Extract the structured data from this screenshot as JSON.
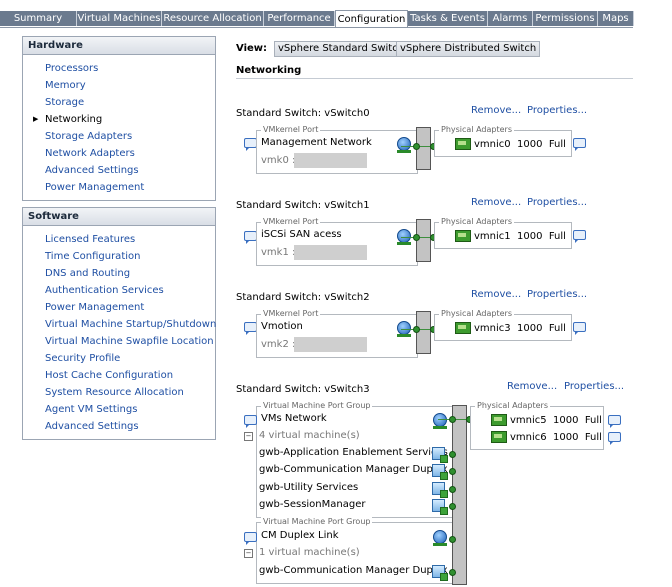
{
  "tabs": [
    "Summary",
    "Virtual Machines",
    "Resource Allocation",
    "Performance",
    "Configuration",
    "Tasks & Events",
    "Alarms",
    "Permissions",
    "Maps"
  ],
  "active_tab": "Configuration",
  "hardware": {
    "title": "Hardware",
    "items": [
      "Processors",
      "Memory",
      "Storage",
      "Networking",
      "Storage Adapters",
      "Network Adapters",
      "Advanced Settings",
      "Power Management"
    ],
    "current": "Networking"
  },
  "software": {
    "title": "Software",
    "items": [
      "Licensed Features",
      "Time Configuration",
      "DNS and Routing",
      "Authentication Services",
      "Power Management",
      "Virtual Machine Startup/Shutdown",
      "Virtual Machine Swapfile Location",
      "Security Profile",
      "Host Cache Configuration",
      "System Resource Allocation",
      "Agent VM Settings",
      "Advanced Settings"
    ]
  },
  "view": {
    "label": "View:",
    "standard": "vSphere Standard Switch",
    "distributed": "vSphere Distributed Switch"
  },
  "section_title": "Networking",
  "links": {
    "remove": "Remove...",
    "properties": "Properties..."
  },
  "legends": {
    "vmkernel": "VMkernel Port",
    "physical": "Physical Adapters",
    "vmpg": "Virtual Machine Port Group"
  },
  "switches": [
    {
      "title": "Standard Switch: vSwitch0",
      "port": "Management Network",
      "vmk": "vmk0 :",
      "nic": "vmnic0",
      "speed": "1000",
      "duplex": "Full"
    },
    {
      "title": "Standard Switch: vSwitch1",
      "port": "iSCSi SAN acess",
      "vmk": "vmk1 :",
      "nic": "vmnic1",
      "speed": "1000",
      "duplex": "Full"
    },
    {
      "title": "Standard Switch: vSwitch2",
      "port": "Vmotion",
      "vmk": "vmk2 :",
      "nic": "vmnic3",
      "speed": "1000",
      "duplex": "Full"
    }
  ],
  "switch3": {
    "title": "Standard Switch: vSwitch3",
    "nics": [
      {
        "nic": "vmnic5",
        "speed": "1000",
        "duplex": "Full"
      },
      {
        "nic": "vmnic6",
        "speed": "1000",
        "duplex": "Full"
      }
    ],
    "groups": [
      {
        "name": "VMs Network",
        "count": "4 virtual machine(s)",
        "vms": [
          "gwb-Application Enablement Services",
          "gwb-Communication Manager Duplex",
          "gwb-Utility Services",
          "gwb-SessionManager"
        ]
      },
      {
        "name": "CM Duplex Link",
        "count": "1 virtual machine(s)",
        "vms": [
          "gwb-Communication Manager Duplex"
        ]
      }
    ]
  }
}
